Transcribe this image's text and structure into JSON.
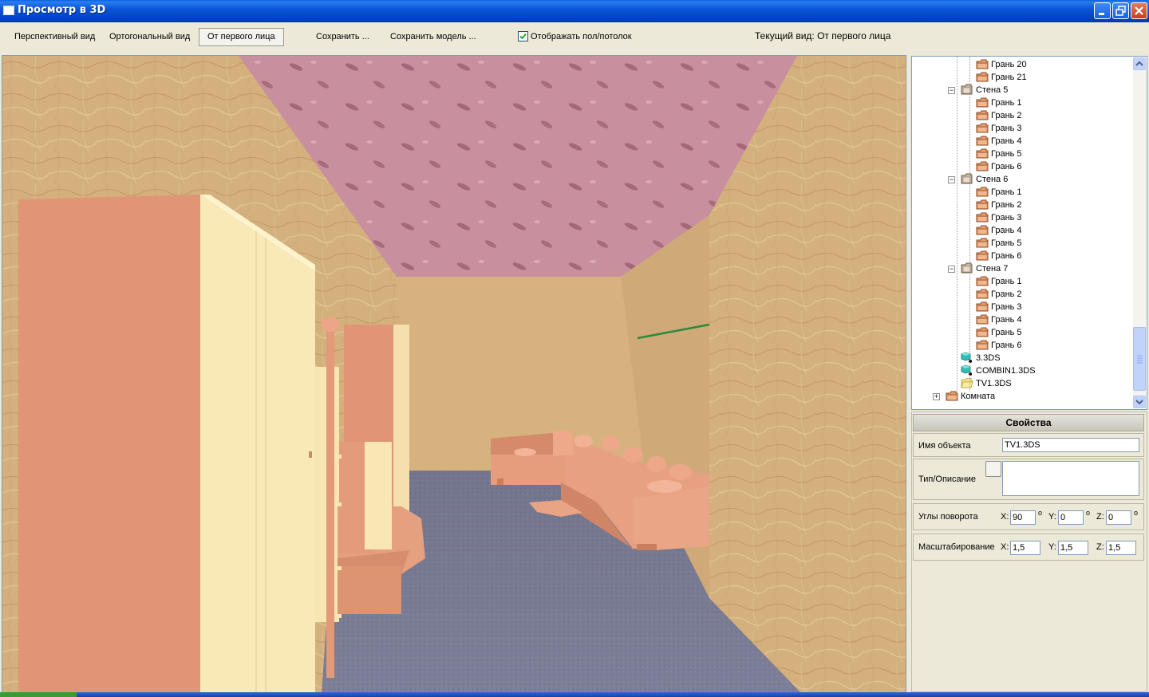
{
  "window": {
    "title": "Просмотр в 3D"
  },
  "toolbar": {
    "perspective": "Перспективный вид",
    "orthogonal": "Ортогональный вид",
    "first_person": "От первого лица",
    "save": "Сохранить ...",
    "save_model": "Сохранить модель ...",
    "show_floor_label": "Отображать пол/потолок",
    "show_floor_checked": true,
    "current_view": "Текущий вид: От первого лица"
  },
  "tree": {
    "items": [
      {
        "label": "Грань  20",
        "icon": "folder-box"
      },
      {
        "label": "Грань  21",
        "icon": "folder-box"
      },
      {
        "label": "Стена 5",
        "icon": "folder-box-open",
        "expander": "−"
      },
      {
        "label": "Грань  1",
        "icon": "folder-box"
      },
      {
        "label": "Грань  2",
        "icon": "folder-box"
      },
      {
        "label": "Грань  3",
        "icon": "folder-box"
      },
      {
        "label": "Грань  4",
        "icon": "folder-box"
      },
      {
        "label": "Грань  5",
        "icon": "folder-box"
      },
      {
        "label": "Грань  6",
        "icon": "folder-box"
      },
      {
        "label": "Стена 6",
        "icon": "folder-box-open",
        "expander": "−"
      },
      {
        "label": "Грань  1",
        "icon": "folder-box"
      },
      {
        "label": "Грань  2",
        "icon": "folder-box"
      },
      {
        "label": "Грань  3",
        "icon": "folder-box"
      },
      {
        "label": "Грань  4",
        "icon": "folder-box"
      },
      {
        "label": "Грань  5",
        "icon": "folder-box"
      },
      {
        "label": "Грань  6",
        "icon": "folder-box"
      },
      {
        "label": "Стена 7",
        "icon": "folder-box-open",
        "expander": "−"
      },
      {
        "label": "Грань  1",
        "icon": "folder-box"
      },
      {
        "label": "Грань  2",
        "icon": "folder-box"
      },
      {
        "label": "Грань  3",
        "icon": "folder-box"
      },
      {
        "label": "Грань  4",
        "icon": "folder-box"
      },
      {
        "label": "Грань  5",
        "icon": "folder-box"
      },
      {
        "label": "Грань  6",
        "icon": "folder-box"
      },
      {
        "label": "3.3DS",
        "icon": "model-cube"
      },
      {
        "label": "COMBIN1.3DS",
        "icon": "model-cube"
      },
      {
        "label": "TV1.3DS",
        "icon": "folder-open-yellow"
      },
      {
        "label": "Комната",
        "icon": "folder-box",
        "expander": "+"
      }
    ]
  },
  "properties": {
    "header": "Свойства",
    "name_label": "Имя объекта",
    "name_value": "TV1.3DS",
    "type_label": "Тип/Описание",
    "type_value": "",
    "rotation_label": "Углы поворота",
    "rotation": {
      "x": "90",
      "y": "0",
      "z": "0"
    },
    "scale_label": "Масштабирование",
    "scale": {
      "x": "1,5",
      "y": "1,5",
      "z": "1,5"
    },
    "axis_x": "X:",
    "axis_y": "Y:",
    "axis_z": "Z:",
    "degree": "o"
  },
  "colors": {
    "title_bar": "#0a56d8",
    "wall": "#d7b583",
    "ceiling": "#c8909e",
    "floor": "#7e7f98",
    "furniture": "#e49a7a",
    "cabinet_face": "#f9e9b7"
  }
}
